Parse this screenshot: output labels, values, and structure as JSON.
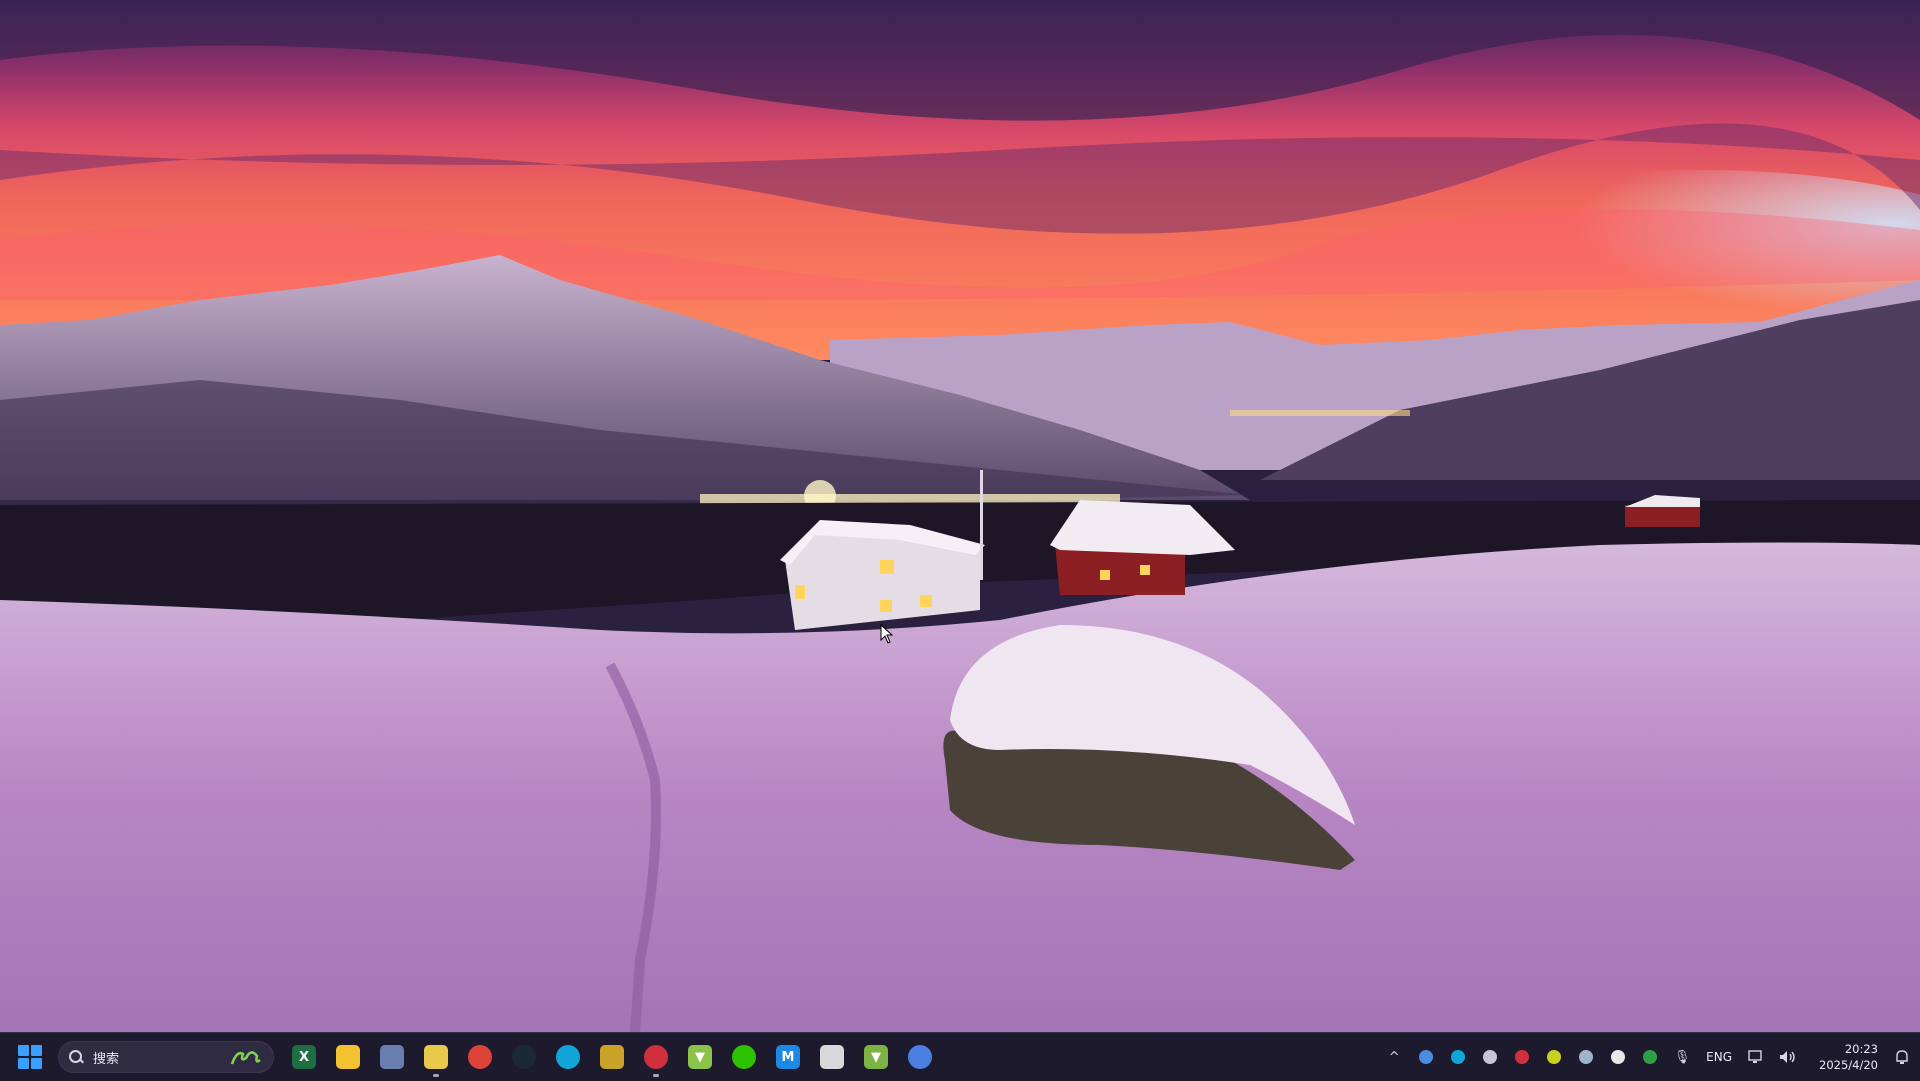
{
  "desktop": {
    "wallpaper": "snowy-mountain-village-sunset"
  },
  "taskbar": {
    "start_icon": "windows-start-icon",
    "search": {
      "text": "搜索",
      "icon": "search-icon"
    },
    "pinned_apps": [
      {
        "name": "excel-app",
        "glyph": "X",
        "color": "#1f6e43",
        "running": false
      },
      {
        "name": "file-explorer-app",
        "glyph": "",
        "color": "#f2c230",
        "running": false
      },
      {
        "name": "avatar-app",
        "glyph": "",
        "color": "#6a7fb0",
        "running": false
      },
      {
        "name": "notes-app",
        "glyph": "",
        "color": "#e8c94a",
        "running": true
      },
      {
        "name": "chrome-app",
        "glyph": "",
        "color": "#db4437",
        "running": false
      },
      {
        "name": "steam-app",
        "glyph": "",
        "color": "#1b2838",
        "running": false
      },
      {
        "name": "ring-app",
        "glyph": "",
        "color": "#12a6d8",
        "running": false
      },
      {
        "name": "shield-app",
        "glyph": "",
        "color": "#c9a227",
        "running": false
      },
      {
        "name": "game-launcher-app",
        "glyph": "",
        "color": "#d22f3c",
        "running": true
      },
      {
        "name": "vector-app",
        "glyph": "▼",
        "color": "#8bc34a",
        "running": false
      },
      {
        "name": "wechat-app",
        "glyph": "",
        "color": "#2dc100",
        "running": false
      },
      {
        "name": "mail-app",
        "glyph": "M",
        "color": "#1e88e5",
        "running": false
      },
      {
        "name": "roblox-app",
        "glyph": "",
        "color": "#d9d9d9",
        "running": false
      },
      {
        "name": "vector-green-app",
        "glyph": "▼",
        "color": "#7cb342",
        "running": false
      },
      {
        "name": "globe-app",
        "glyph": "",
        "color": "#4a7ee0",
        "running": false
      }
    ],
    "tray": {
      "items": [
        {
          "name": "chevron-up-icon",
          "glyph": "^"
        },
        {
          "name": "chrome-tray-icon",
          "color": "#4a8de0"
        },
        {
          "name": "ring-tray-icon",
          "color": "#12a6d8"
        },
        {
          "name": "list-tray-icon",
          "color": "#c8c4d8"
        },
        {
          "name": "game-tray-icon",
          "color": "#d22f3c"
        },
        {
          "name": "vector-tray-icon",
          "color": "#c9d11f"
        },
        {
          "name": "steam-tray-icon",
          "color": "#9fb4cc"
        },
        {
          "name": "g-tray-icon",
          "color": "#e8e8e8"
        },
        {
          "name": "code-tray-icon",
          "color": "#2ea043"
        },
        {
          "name": "microphone-icon",
          "glyph": "🎙"
        }
      ],
      "language": "ENG",
      "network_icon": "network-icon",
      "volume_icon": "volume-icon",
      "time": "20:23",
      "date": "2025/4/20",
      "notification_icon": "notification-icon"
    }
  }
}
